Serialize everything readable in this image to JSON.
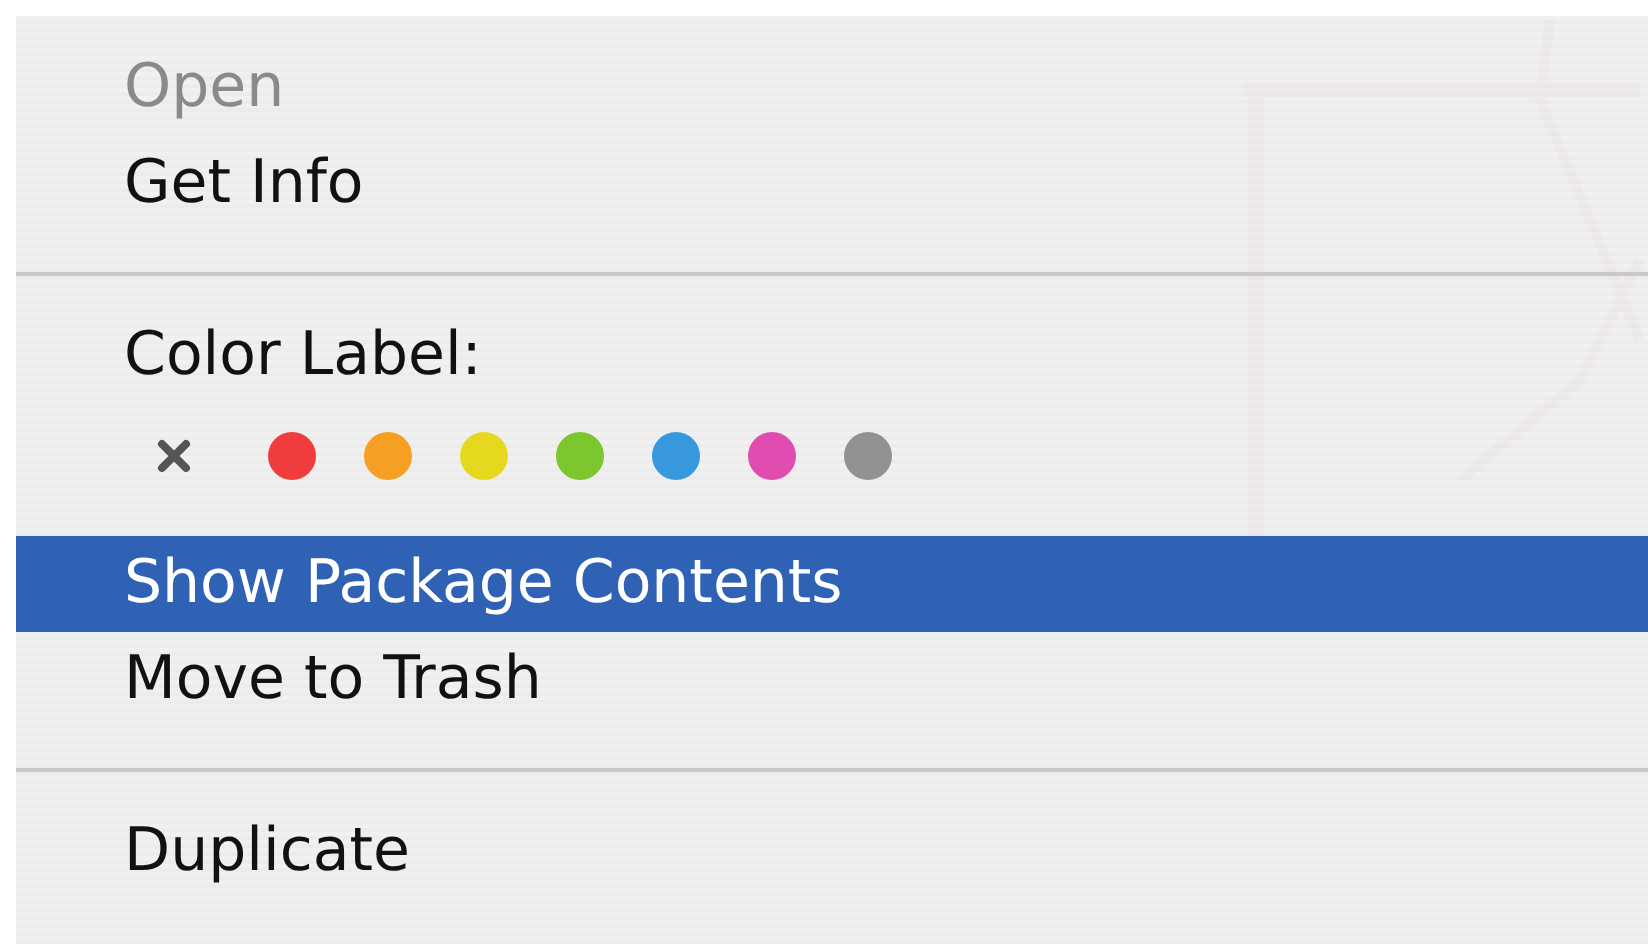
{
  "context_menu": {
    "items": [
      {
        "kind": "item",
        "label": "Open",
        "disabled": true,
        "selected": false
      },
      {
        "kind": "item",
        "label": "Get Info",
        "disabled": false,
        "selected": false
      },
      {
        "kind": "separator"
      },
      {
        "kind": "heading",
        "label": "Color Label:"
      },
      {
        "kind": "swatches",
        "swatches": [
          {
            "kind": "none"
          },
          {
            "kind": "color",
            "color": "#f03c3c"
          },
          {
            "kind": "color",
            "color": "#f5a023"
          },
          {
            "kind": "color",
            "color": "#e6d81e"
          },
          {
            "kind": "color",
            "color": "#7cc62e"
          },
          {
            "kind": "color",
            "color": "#3898de"
          },
          {
            "kind": "color",
            "color": "#e04caf"
          },
          {
            "kind": "color",
            "color": "#929292"
          }
        ]
      },
      {
        "kind": "item",
        "label": "Show Package Contents",
        "disabled": false,
        "selected": true
      },
      {
        "kind": "item",
        "label": "Move to Trash",
        "disabled": false,
        "selected": false
      },
      {
        "kind": "separator"
      },
      {
        "kind": "item",
        "label": "Duplicate",
        "disabled": false,
        "selected": false
      }
    ]
  }
}
